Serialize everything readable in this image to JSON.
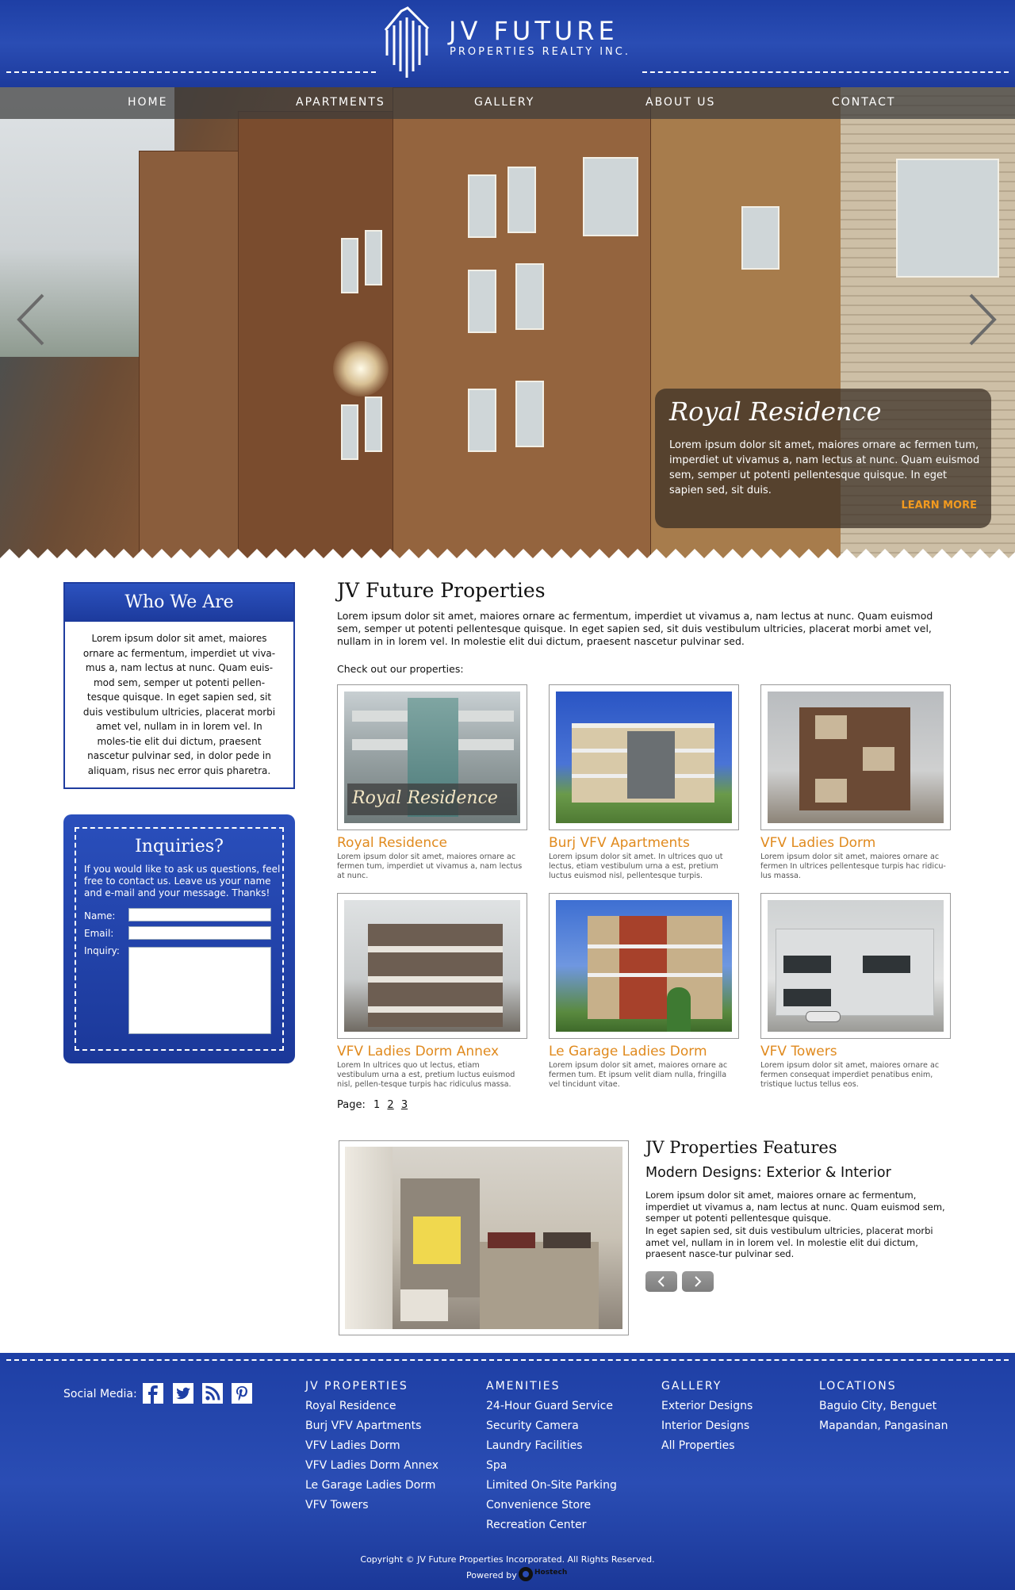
{
  "header": {
    "logo_title": "JV FUTURE",
    "logo_subtitle": "PROPERTIES REALTY INC."
  },
  "nav": {
    "items": [
      {
        "label": "HOME"
      },
      {
        "label": "APARTMENTS"
      },
      {
        "label": "GALLERY"
      },
      {
        "label": "ABOUT US"
      },
      {
        "label": "CONTACT"
      }
    ]
  },
  "hero": {
    "caption_title": "Royal Residence",
    "caption_body": "Lorem ipsum dolor sit amet, maiores ornare ac fermen tum, imperdiet ut vivamus a, nam lectus at nunc. Quam euismod sem, semper ut potenti pellentesque quisque.  In eget sapien sed, sit duis.",
    "learn_more": "LEARN MORE",
    "prev_icon": "chevron-left-icon",
    "next_icon": "chevron-right-icon"
  },
  "who": {
    "title": "Who We Are",
    "body": "Lorem ipsum dolor sit amet, maiores ornare ac fermentum, imperdiet ut viva-mus a, nam lectus at nunc. Quam euis-mod sem, semper ut potenti pellen-tesque quisque. In eget sapien sed, sit duis vestibulum ultricies, placerat morbi amet vel, nullam in in lorem vel. In moles-tie elit dui dictum, praesent nascetur pulvinar sed, in dolor pede in aliquam, risus nec error quis pharetra."
  },
  "inquiries": {
    "title": "Inquiries?",
    "description": "If you would like to ask us questions, feel free to contact us.  Leave us your name and e-mail and your message.  Thanks!",
    "name_label": "Name:",
    "email_label": "Email:",
    "inquiry_label": "Inquiry:",
    "name_value": "",
    "email_value": "",
    "inquiry_value": ""
  },
  "main": {
    "title": "JV Future Properties",
    "intro": "Lorem ipsum dolor sit amet, maiores ornare ac fermentum, imperdiet ut vivamus a, nam lectus at nunc. Quam euismod sem, semper ut potenti pellentesque quisque. In eget sapien sed, sit duis vestibulum ultricies, placerat morbi amet vel, nullam in in lorem vel. In molestie elit dui dictum, praesent nascetur pulvinar sed.",
    "check_out": "Check out our properties:",
    "properties": [
      {
        "name": "Royal Residence",
        "desc": "Lorem ipsum dolor sit amet, maiores ornare ac fermen tum, imperdiet ut vivamus a, nam lectus at nunc.",
        "image_sign": "Royal Residence"
      },
      {
        "name": "Burj VFV Apartments",
        "desc": "Lorem ipsum dolor sit amet. In ultrices quo ut lectus, etiam vestibulum urna a est, pretium luctus euismod nisl, pellentesque turpis."
      },
      {
        "name": "VFV Ladies Dorm",
        "desc": "Lorem ipsum dolor sit amet, maiores ornare ac fermen In ultrices pellentesque turpis hac ridicu-lus massa."
      },
      {
        "name": "VFV Ladies Dorm Annex",
        "desc": "Lorem In ultrices quo ut lectus, etiam vestibulum urna a est, pretium luctus euismod nisl, pellen-tesque turpis hac ridiculus massa."
      },
      {
        "name": "Le Garage Ladies Dorm",
        "desc": "Lorem ipsum dolor sit amet, maiores ornare ac fermen tum.  Et ipsum velit diam nulla, fringilla vel tincidunt vitae."
      },
      {
        "name": "VFV Towers",
        "desc": "Lorem ipsum dolor sit amet, maiores ornare ac fermen consequat imperdiet penatibus enim, tristique luctus tellus eos."
      }
    ],
    "page_label": "Page:",
    "pages": [
      "1",
      "2",
      "3"
    ]
  },
  "features": {
    "title": "JV Properties Features",
    "subtitle": "Modern Designs: Exterior & Interior",
    "p1": "Lorem ipsum dolor sit amet, maiores ornare ac fermentum, imperdiet ut vivamus a, nam lectus at nunc. Quam euismod sem, semper ut potenti pellentesque quisque.",
    "p2": "In eget sapien sed, sit duis vestibulum ultricies, placerat morbi amet vel, nullam in in lorem vel. In molestie elit dui dictum, praesent nasce-tur pulvinar sed.",
    "prev_icon": "chevron-left-icon",
    "next_icon": "chevron-right-icon"
  },
  "footer": {
    "social_label": "Social Media:",
    "social_icons": [
      "facebook-icon",
      "twitter-icon",
      "rss-icon",
      "pinterest-icon"
    ],
    "columns": [
      {
        "heading": "JV PROPERTIES",
        "links": [
          "Royal Residence",
          "Burj VFV Apartments",
          "VFV Ladies Dorm",
          "VFV Ladies Dorm Annex",
          "Le Garage Ladies Dorm",
          "VFV Towers"
        ]
      },
      {
        "heading": "AMENITIES",
        "links": [
          "24-Hour Guard Service",
          "Security Camera",
          "Laundry Facilities",
          "Spa",
          "Limited On-Site Parking",
          "Convenience Store",
          "Recreation Center"
        ]
      },
      {
        "heading": "GALLERY",
        "links": [
          "Exterior Designs",
          "Interior Designs",
          "All Properties"
        ]
      },
      {
        "heading": "LOCATIONS",
        "links": [
          "Baguio City, Benguet",
          "Mapandan, Pangasinan"
        ]
      }
    ],
    "copyright": "Copyright © JV Future Properties Incorporated. All Rights Reserved.",
    "powered_by": "Powered by",
    "powered_logo_text": "Hostech"
  },
  "colors": {
    "brand_blue": "#1e3fa5",
    "accent_orange": "#e08a1e",
    "learn_more": "#f29a1f"
  }
}
